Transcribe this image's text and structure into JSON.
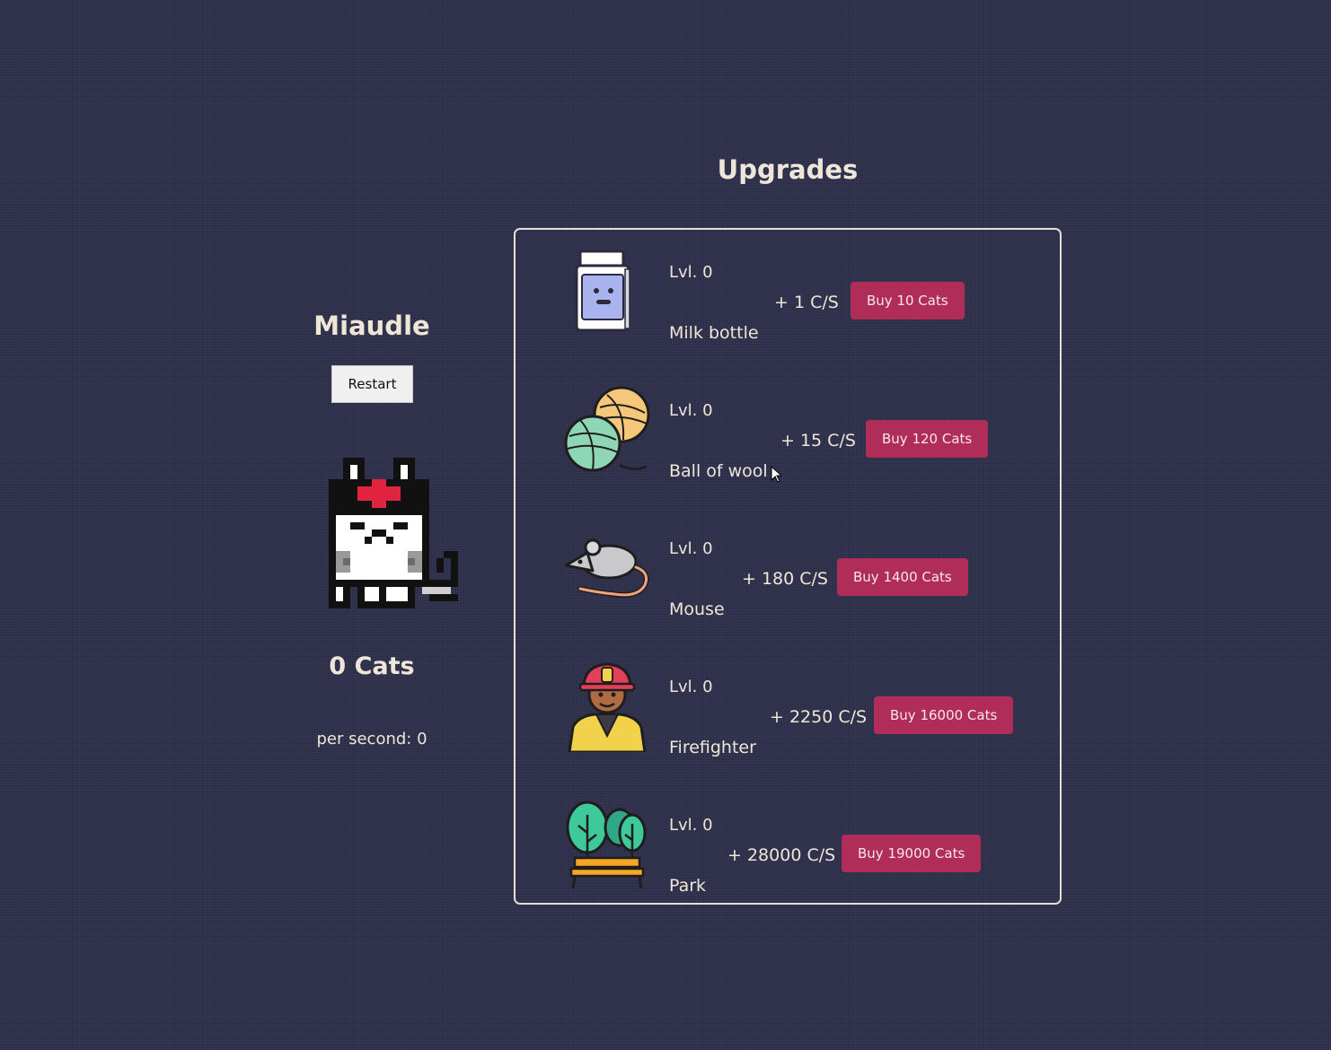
{
  "game": {
    "title": "Miaudle",
    "restart_label": "Restart",
    "cat_count": "0 Cats",
    "per_second": "per second: 0"
  },
  "upgrades": {
    "title": "Upgrades",
    "items": [
      {
        "icon": "milk-bottle-icon",
        "level": "Lvl. 0",
        "name": "Milk bottle",
        "rate": "+ 1 C/S",
        "buy_label": "Buy 10 Cats"
      },
      {
        "icon": "ball-of-wool-icon",
        "level": "Lvl. 0",
        "name": "Ball of wool",
        "rate": "+ 15 C/S",
        "buy_label": "Buy 120 Cats"
      },
      {
        "icon": "mouse-icon",
        "level": "Lvl. 0",
        "name": "Mouse",
        "rate": "+ 180 C/S",
        "buy_label": "Buy 1400 Cats"
      },
      {
        "icon": "firefighter-icon",
        "level": "Lvl. 0",
        "name": "Firefighter",
        "rate": "+ 2250 C/S",
        "buy_label": "Buy 16000 Cats"
      },
      {
        "icon": "park-icon",
        "level": "Lvl. 0",
        "name": "Park",
        "rate": "+ 28000 C/S",
        "buy_label": "Buy 19000 Cats"
      }
    ]
  },
  "colors": {
    "background": "#2d2e4a",
    "text": "#efe6d8",
    "buy_button": "#b02d5a",
    "panel_border": "#e6dfd6"
  }
}
